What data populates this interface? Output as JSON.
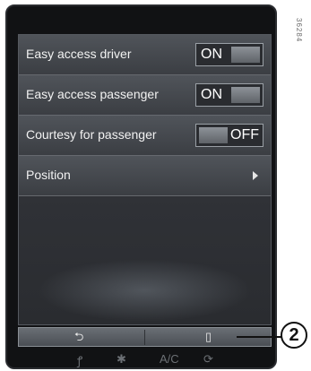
{
  "menu": {
    "rows": [
      {
        "label": "Easy access driver",
        "toggle": "ON",
        "state": "on"
      },
      {
        "label": "Easy access passenger",
        "toggle": "ON",
        "state": "on"
      },
      {
        "label": "Courtesy for passenger",
        "toggle": "OFF",
        "state": "off"
      },
      {
        "label": "Position"
      }
    ]
  },
  "toolbar": {
    "back_icon": "back-arrow-icon",
    "back_glyph": "⮌",
    "page_icon": "document-icon",
    "page_glyph": "▯"
  },
  "bottom": {
    "ac_label": "A/C",
    "icons": [
      "seat-heat-icon",
      "fan-icon",
      "ac-label",
      "recirculation-icon"
    ]
  },
  "side_code": "36284",
  "callout": {
    "number": "2"
  }
}
